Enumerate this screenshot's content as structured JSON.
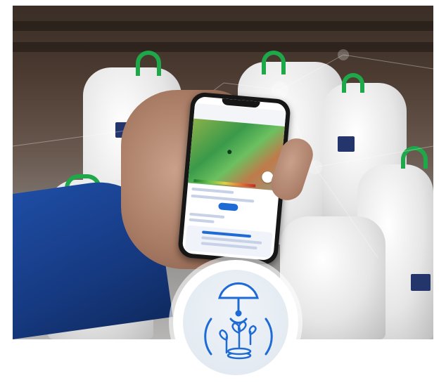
{
  "scene": {
    "accent_color": "#1f6bd6",
    "strap_color": "#1ea84a",
    "sleeve_color": "#1f4ea6",
    "icon_names": [
      "satellite-dish-icon",
      "plant-growth-icon",
      "coin-stack-icon"
    ]
  }
}
